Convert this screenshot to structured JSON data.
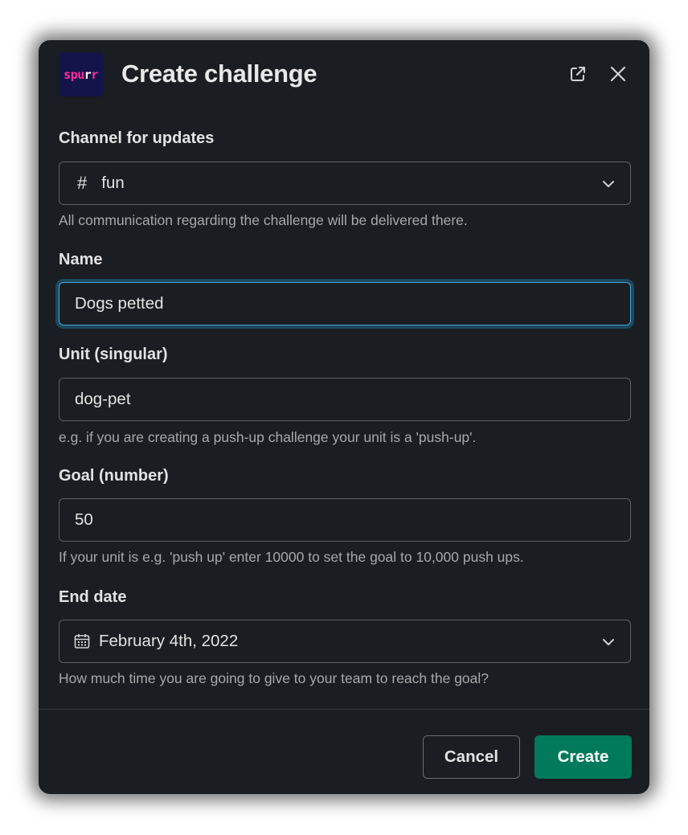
{
  "modal": {
    "title": "Create challenge",
    "logo": {
      "part1": "spu",
      "part2": "r",
      "part3": "r"
    },
    "icons": {
      "popout": "external-link-icon",
      "close": "close-icon"
    }
  },
  "fields": {
    "channel": {
      "label": "Channel for updates",
      "prefix": "#",
      "value": "fun",
      "hint": "All communication regarding the challenge will be delivered there."
    },
    "name": {
      "label": "Name",
      "value": "Dogs petted"
    },
    "unit": {
      "label": "Unit (singular)",
      "value": "dog-pet",
      "hint": "e.g. if you are creating a push-up challenge your unit is a 'push-up'."
    },
    "goal": {
      "label": "Goal (number)",
      "value": "50",
      "hint": "If your unit is e.g. 'push up' enter 10000 to set the goal to 10,000 push ups."
    },
    "end_date": {
      "label": "End date",
      "value": "February 4th, 2022",
      "hint": "How much time you are going to give to your team to reach the goal?"
    }
  },
  "footer": {
    "cancel_label": "Cancel",
    "create_label": "Create"
  },
  "colors": {
    "modal_bg": "#1a1d21",
    "primary_button": "#007a5a",
    "focus_ring": "#1d9bd1",
    "logo_bg": "#14144a",
    "logo_accent": "#ff2e9a"
  }
}
